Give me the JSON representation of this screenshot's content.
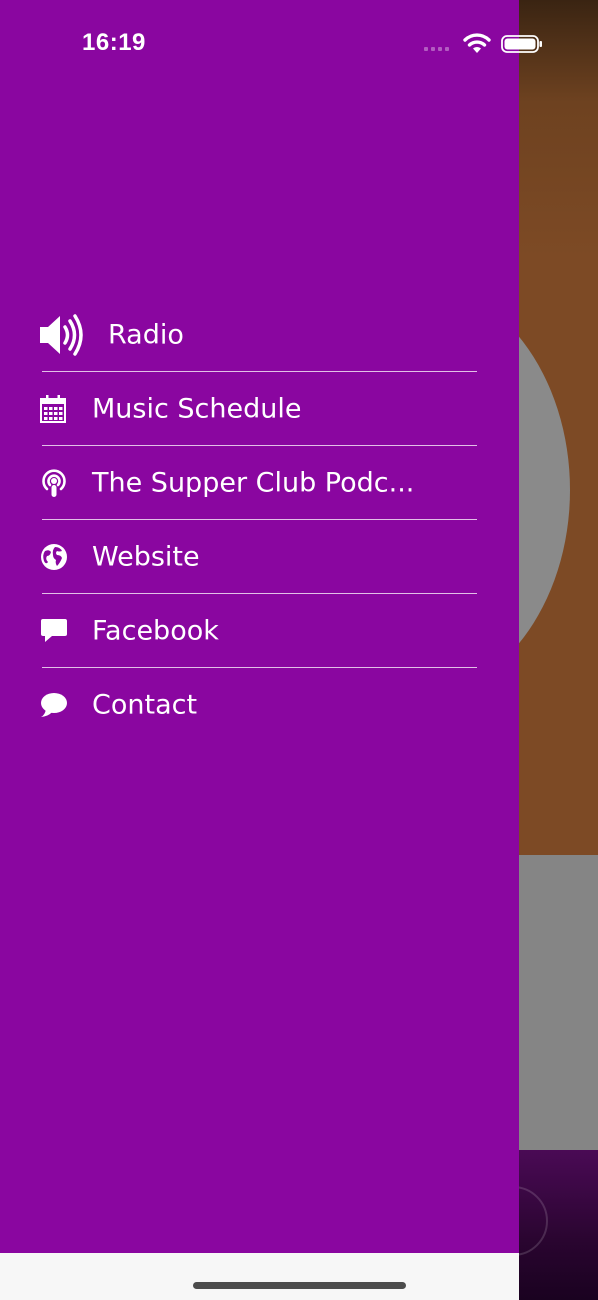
{
  "status_bar": {
    "time": "16:19"
  },
  "menu": {
    "items": [
      {
        "label": "Radio",
        "icon": "speaker-icon"
      },
      {
        "label": "Music Schedule",
        "icon": "calendar-icon"
      },
      {
        "label": "The Supper Club Podc...",
        "icon": "podcast-icon"
      },
      {
        "label": "Website",
        "icon": "globe-icon"
      },
      {
        "label": "Facebook",
        "icon": "comment-square-icon"
      },
      {
        "label": "Contact",
        "icon": "speech-bubble-icon"
      }
    ]
  },
  "colors": {
    "drawer_background": "#8a06a0",
    "text": "#ffffff"
  }
}
